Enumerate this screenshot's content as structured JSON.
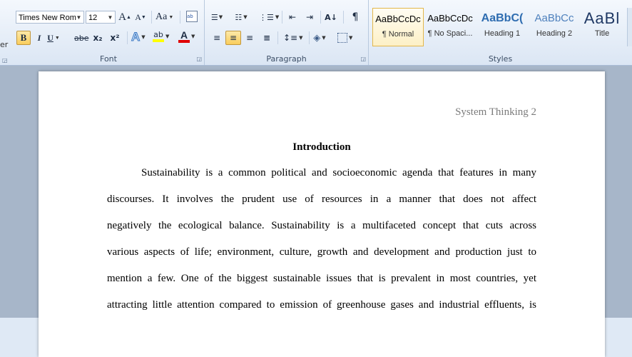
{
  "ribbon": {
    "left_edge_label": "er",
    "font_group": {
      "label": "Font",
      "font_name": "Times New Rom",
      "font_size": "12",
      "grow_font": "A",
      "shrink_font": "A",
      "change_case": "Aa",
      "clear_formatting": "ab",
      "bold": "B",
      "italic": "I",
      "underline": "U",
      "strikethrough": "abe",
      "subscript": "x₂",
      "superscript": "x²",
      "text_effects": "A",
      "highlight": "ab",
      "font_color": "A"
    },
    "paragraph_group": {
      "label": "Paragraph",
      "show_marks": "¶"
    },
    "styles_group": {
      "label": "Styles",
      "tiles": [
        {
          "preview": "AaBbCcDc",
          "name": "¶ Normal"
        },
        {
          "preview": "AaBbCcDc",
          "name": "¶ No Spaci..."
        },
        {
          "preview": "AaBbC(",
          "name": "Heading 1"
        },
        {
          "preview": "AaBbCc",
          "name": "Heading 2"
        },
        {
          "preview": "AaBl",
          "name": "Title"
        }
      ]
    }
  },
  "document": {
    "header": "System Thinking  2",
    "heading": "Introduction",
    "lines": [
      "Sustainability is a common political and socioeconomic agenda that features in many",
      "discourses. It involves the prudent use of resources in a manner that does not affect",
      "negatively the ecological balance. Sustainability is a multifaceted concept that cuts across",
      "various aspects of life; environment, culture, growth and development and production just to",
      "mention a few. One of the biggest sustainable issues that is prevalent in most countries, yet",
      "attracting little attention compared to emission of greenhouse gases and industrial effluents, is"
    ]
  },
  "colors": {
    "highlight_yellow": "#ffff00",
    "font_color_red": "#e00000",
    "selected_button": "#f9cd5c"
  }
}
